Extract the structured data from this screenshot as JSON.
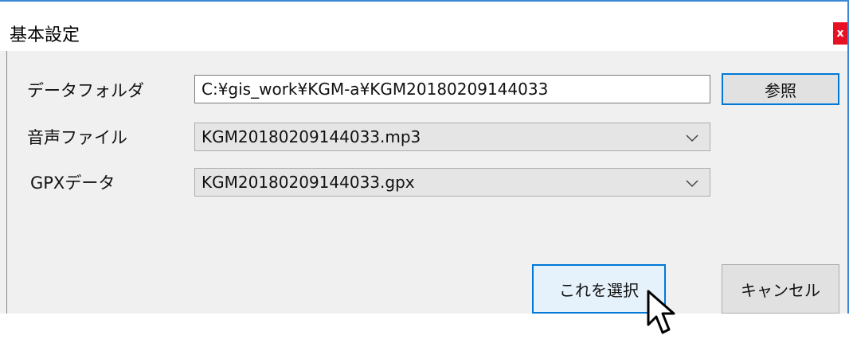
{
  "window": {
    "title": "基本設定",
    "close_glyph": "x"
  },
  "form": {
    "data_folder": {
      "label": "データフォルダ",
      "value": "C:¥gis_work¥KGM-a¥KGM20180209144033"
    },
    "browse_button": "参照",
    "audio_file": {
      "label": "音声ファイル",
      "value": "KGM20180209144033.mp3"
    },
    "gpx_data": {
      "label": "GPXデータ",
      "value": "KGM20180209144033.gpx"
    }
  },
  "buttons": {
    "select": "これを選択",
    "cancel": "キャンセル"
  },
  "icons": {
    "dropdown": "chevron-down-icon",
    "pointer": "mouse-pointer-icon"
  },
  "colors": {
    "accent": "#0078d7",
    "close": "#e81123",
    "frame": "#3c86d6"
  }
}
